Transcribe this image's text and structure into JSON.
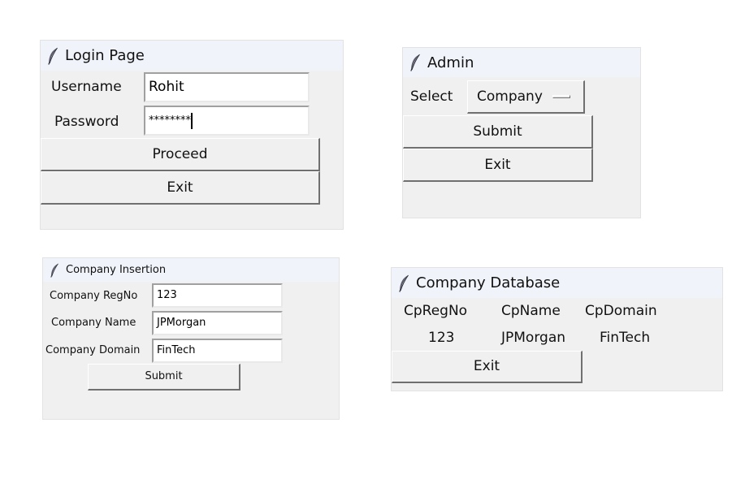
{
  "login": {
    "title": "Login Page",
    "username_label": "Username",
    "username_value": "Rohit",
    "password_label": "Password",
    "password_value": "********",
    "proceed_label": "Proceed",
    "exit_label": "Exit"
  },
  "admin": {
    "title": "Admin",
    "select_label": "Select",
    "select_value": "Company",
    "submit_label": "Submit",
    "exit_label": "Exit"
  },
  "insertion": {
    "title": "Company Insertion",
    "regno_label": "Company RegNo",
    "regno_value": "123",
    "name_label": "Company Name",
    "name_value": "JPMorgan",
    "domain_label": "Company Domain",
    "domain_value": "FinTech",
    "submit_label": "Submit"
  },
  "database": {
    "title": "Company Database",
    "columns": [
      "CpRegNo",
      "CpName",
      "CpDomain"
    ],
    "rows": [
      [
        "123",
        "JPMorgan",
        "FinTech"
      ]
    ],
    "exit_label": "Exit"
  },
  "icons": {
    "window_icon": "feather-icon"
  }
}
